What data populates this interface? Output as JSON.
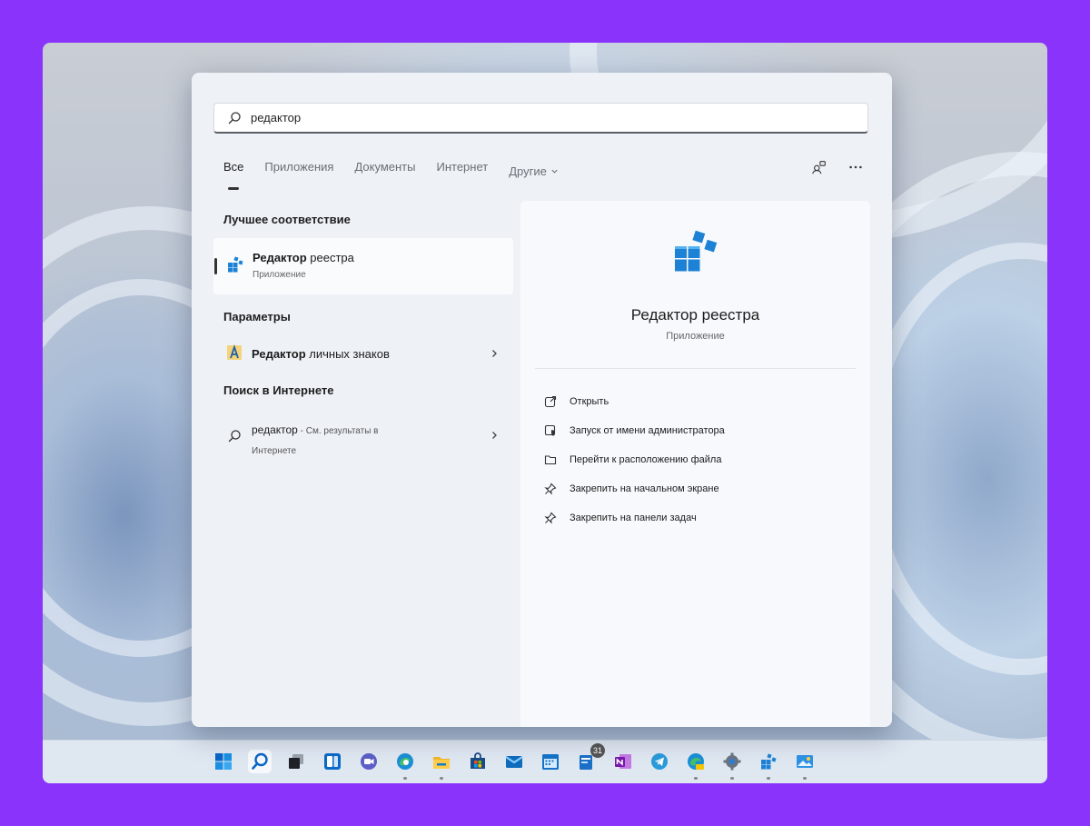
{
  "search": {
    "query": "редактор"
  },
  "tabs": [
    "Все",
    "Приложения",
    "Документы",
    "Интернет",
    "Другие"
  ],
  "sections": {
    "best_match": "Лучшее соответствие",
    "settings": "Параметры",
    "web_search": "Поиск в Интернете"
  },
  "best_match": {
    "title_bold": "Редактор",
    "title_rest": " реестра",
    "subtitle": "Приложение"
  },
  "settings_item": {
    "label_bold": "Редактор",
    "label_rest": " личных знаков"
  },
  "web_item": {
    "query": "редактор",
    "suffix": " - См. результаты в",
    "line2": "Интернете"
  },
  "detail": {
    "app_name": "Редактор реестра",
    "app_type": "Приложение",
    "actions": [
      {
        "label": "Открыть",
        "icon": "open-icon"
      },
      {
        "label": "Запуск от имени администратора",
        "icon": "admin-shield-icon"
      },
      {
        "label": "Перейти к расположению файла",
        "icon": "folder-icon"
      },
      {
        "label": "Закрепить на начальном экране",
        "icon": "pin-icon"
      },
      {
        "label": "Закрепить на панели задач",
        "icon": "pin-icon"
      }
    ]
  },
  "taskbar": {
    "news_badge": "31",
    "icons": [
      "windows-start-icon",
      "search-icon",
      "task-view-icon",
      "widgets-icon",
      "teams-chat-icon",
      "edge-icon",
      "file-explorer-icon",
      "store-icon",
      "mail-icon",
      "calendar-icon",
      "news-icon",
      "onenote-icon",
      "telegram-icon",
      "edge-canary-icon",
      "settings-icon",
      "registry-editor-icon",
      "photos-icon"
    ]
  },
  "colors": {
    "accent": "#0067c0",
    "background": "#8a33fb",
    "panel": "#eef2f7"
  }
}
